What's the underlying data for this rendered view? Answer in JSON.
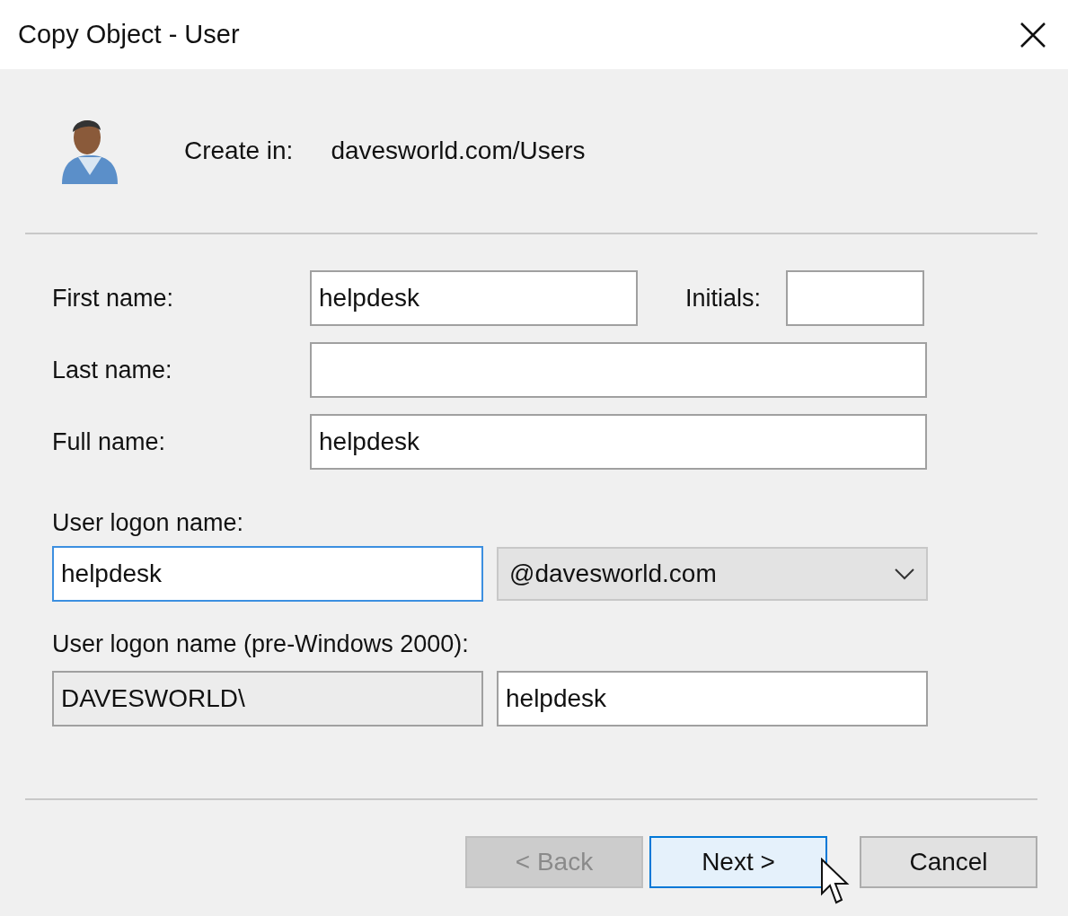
{
  "window": {
    "title": "Copy Object - User"
  },
  "header": {
    "create_in_label": "Create in:",
    "create_in_value": "davesworld.com/Users"
  },
  "first_name": {
    "label": "First name:",
    "value": "helpdesk"
  },
  "initials": {
    "label": "Initials:"
  },
  "last_name": {
    "label": "Last name:"
  },
  "full_name": {
    "label": "Full name:",
    "value": "helpdesk"
  },
  "logon": {
    "label": "User logon name:",
    "value": "helpdesk",
    "focused": true,
    "domain": "@davesworld.com"
  },
  "pre2000": {
    "label": "User logon name (pre-Windows 2000):",
    "domain": "DAVESWORLD\\",
    "domain_disabled": true,
    "value": "helpdesk"
  },
  "buttons": [
    {
      "label": "< Back",
      "disabled": true,
      "focused": false
    },
    {
      "label": "Next >",
      "disabled": false,
      "focused": true
    },
    {
      "label": "Cancel",
      "disabled": false,
      "focused": false
    }
  ]
}
